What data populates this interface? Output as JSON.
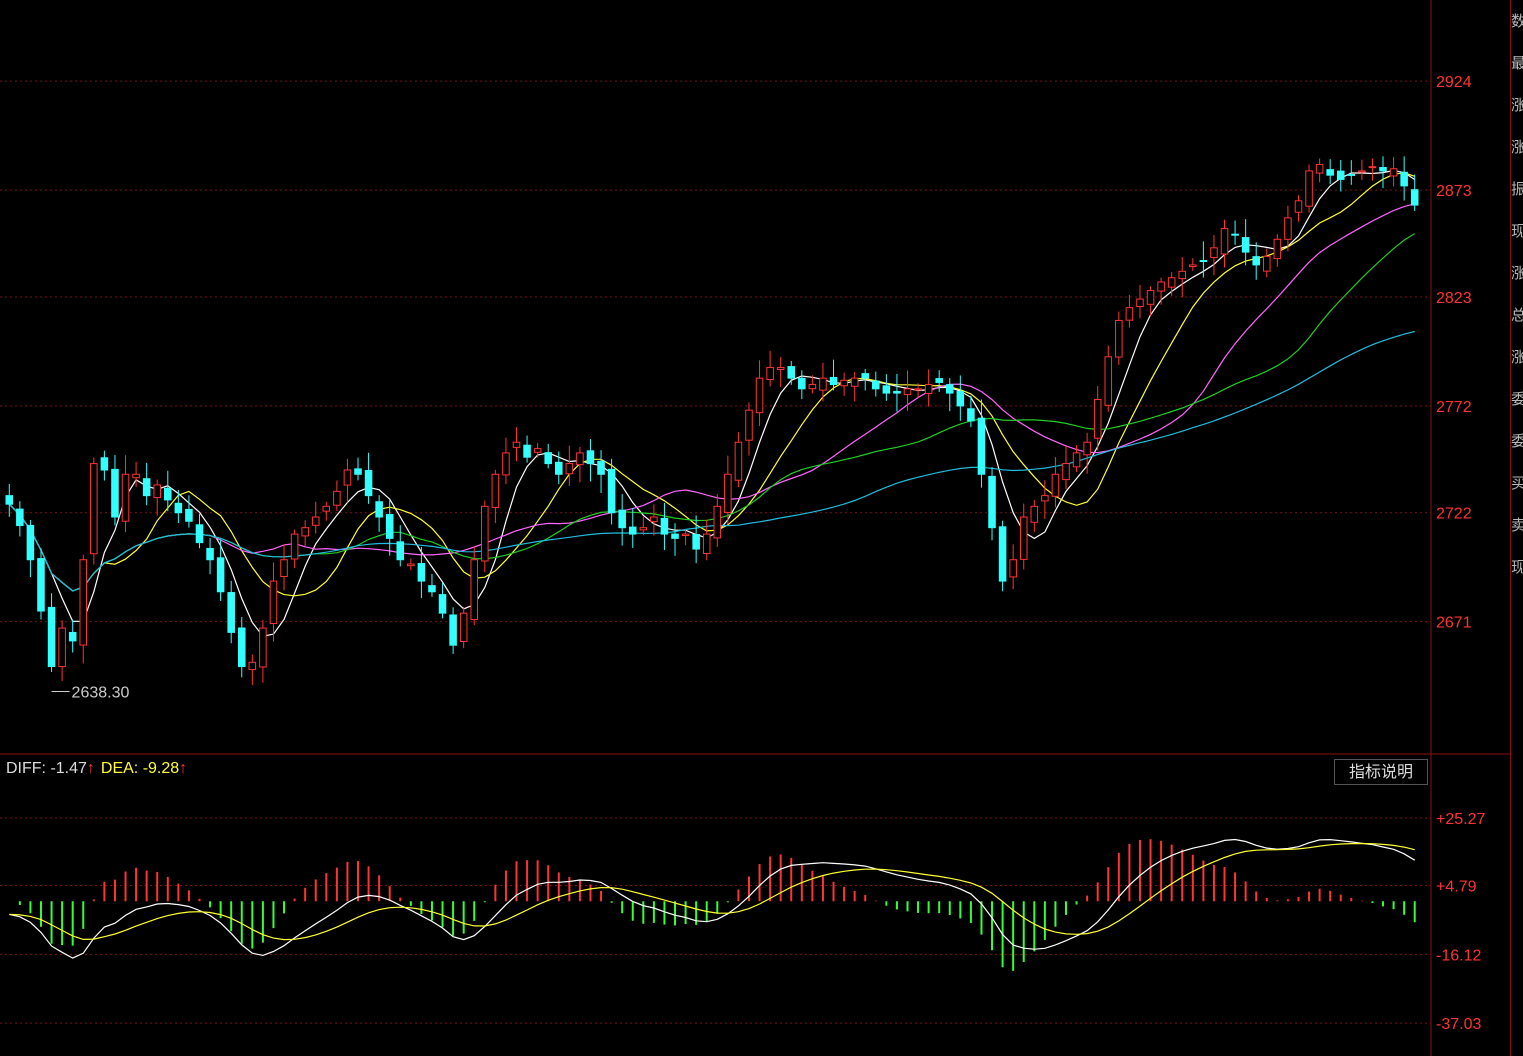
{
  "chart_data": [
    {
      "type": "candlestick",
      "panel": "price",
      "ylim": [
        2610,
        2962
      ],
      "y_ticks": [
        2924,
        2873,
        2823,
        2772,
        2722,
        2671
      ],
      "min_marker": "2638.30",
      "colors": {
        "up": "#ff3333",
        "down": "#33ffff",
        "grid": "#7a1414"
      },
      "closes": [
        2726,
        2716,
        2700,
        2676,
        2650,
        2668,
        2662,
        2700,
        2745,
        2742,
        2720,
        2740,
        2740,
        2730,
        2735,
        2728,
        2722,
        2718,
        2708,
        2700,
        2685,
        2666,
        2650,
        2652,
        2668,
        2690,
        2700,
        2712,
        2715,
        2720,
        2725,
        2732,
        2742,
        2740,
        2730,
        2720,
        2710,
        2700,
        2698,
        2690,
        2685,
        2675,
        2660,
        2675,
        2700,
        2725,
        2740,
        2750,
        2755,
        2748,
        2752,
        2745,
        2740,
        2745,
        2750,
        2745,
        2740,
        2722,
        2715,
        2712,
        2715,
        2720,
        2712,
        2710,
        2712,
        2705,
        2712,
        2725,
        2740,
        2755,
        2770,
        2785,
        2790,
        2790,
        2785,
        2780,
        2782,
        2785,
        2782,
        2784,
        2785,
        2785,
        2780,
        2778,
        2778,
        2780,
        2780,
        2782,
        2783,
        2778,
        2772,
        2765,
        2740,
        2715,
        2690,
        2700,
        2720,
        2725,
        2730,
        2740,
        2745,
        2750,
        2755,
        2775,
        2795,
        2812,
        2818,
        2822,
        2826,
        2830,
        2832,
        2835,
        2838,
        2840,
        2846,
        2855,
        2852,
        2844,
        2838,
        2842,
        2850,
        2860,
        2868,
        2882,
        2885,
        2880,
        2878,
        2880,
        2882,
        2884,
        2882,
        2883,
        2875,
        2866
      ]
    },
    {
      "type": "line",
      "panel": "macd",
      "ylim": [
        -47,
        35
      ],
      "y_ticks": [
        "+25.27",
        "+4.79",
        "-16.12",
        "-37.03"
      ],
      "colors": {
        "diff": "#ffffff",
        "dea": "#ffff33",
        "hist_up": "#ff3333",
        "hist_down": "#33ff33"
      }
    }
  ],
  "macd": {
    "diff_label": "DIFF: -1.47",
    "dea_label": "DEA: -9.28",
    "arrow": "↑",
    "help_button": "指标说明"
  },
  "side_strip": [
    "数",
    "最",
    "涨",
    "涨",
    "振",
    "现",
    "涨",
    "总",
    "涨",
    "委",
    "委",
    "买",
    "卖",
    "现"
  ]
}
